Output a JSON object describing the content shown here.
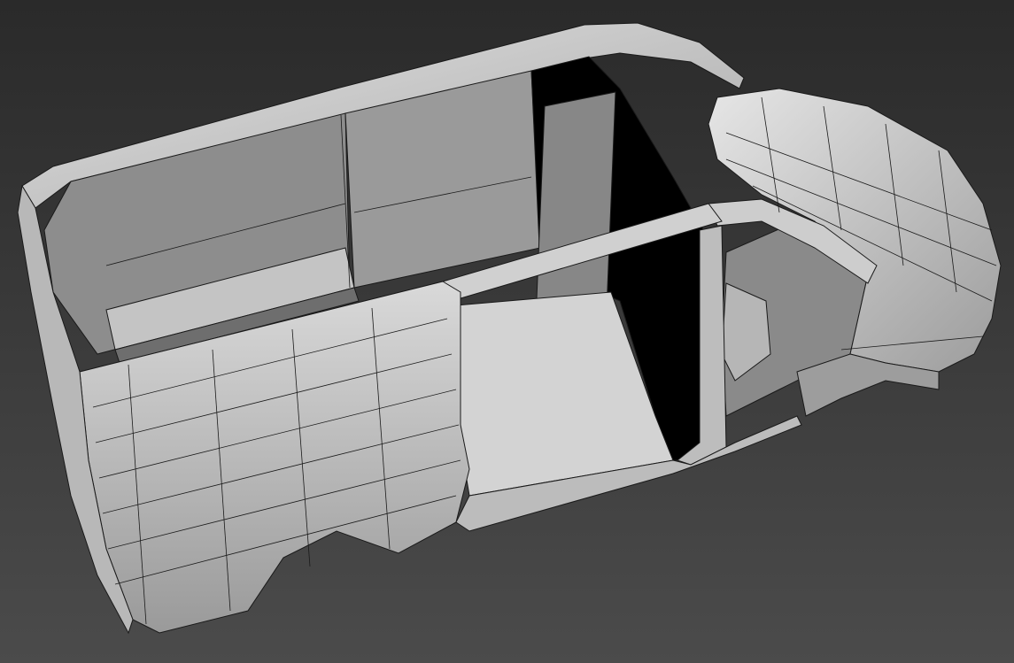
{
  "viewport": {
    "background_top": "#2c2c2c",
    "background_bottom": "#4a4a4a",
    "shading": "clay-with-wireframe-edges",
    "model": "van-body-shell-cutaway"
  },
  "colors": {
    "surface_light": "#cfcfcf",
    "surface_mid": "#a9a9a9",
    "surface_dark": "#7c7c7c",
    "interior_panel": "#8e8e8e",
    "void": "#000000",
    "edge_line": "#1a1a1a"
  }
}
